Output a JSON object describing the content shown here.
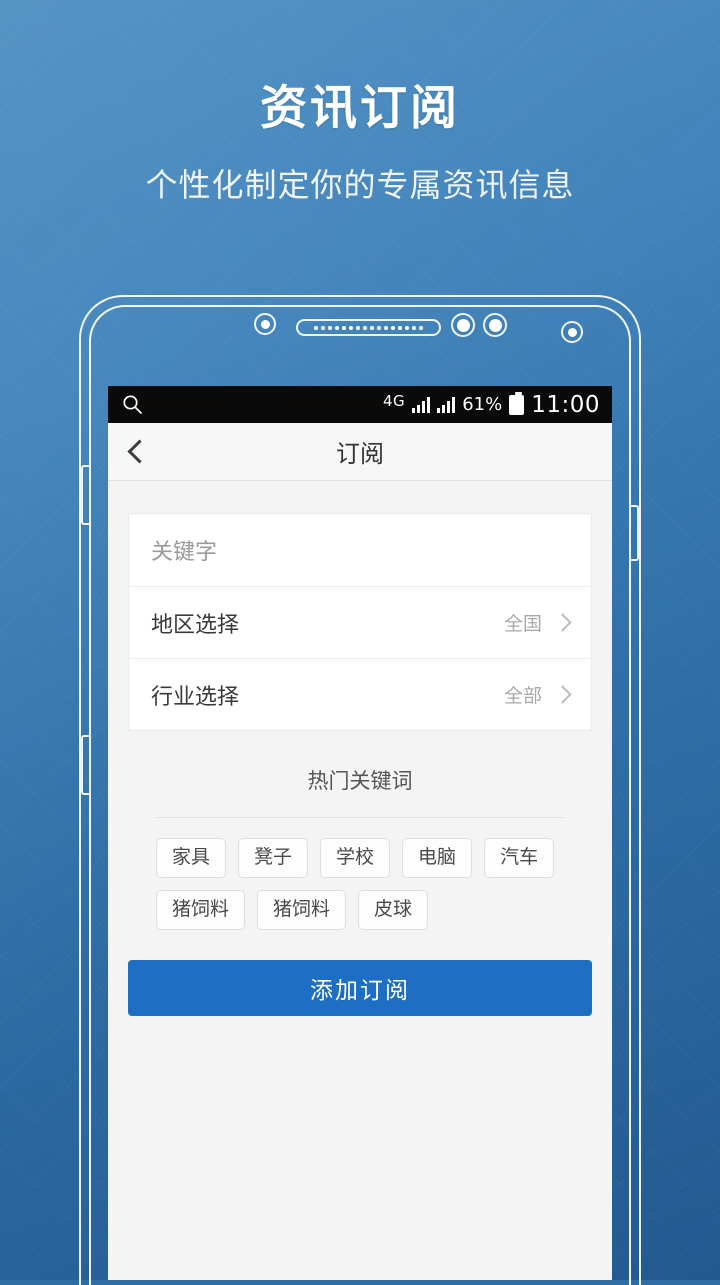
{
  "hero": {
    "title": "资讯订阅",
    "subtitle": "个性化制定你的专属资讯信息"
  },
  "phone": {
    "statusbar": {
      "search_icon": "search-icon",
      "network": "4G",
      "battery_percent": "61%",
      "battery_icon": "battery-icon",
      "clock": "11:00"
    },
    "navbar": {
      "back_icon": "chevron-left-icon",
      "title": "订阅"
    },
    "form": {
      "rows": [
        {
          "label": "关键字",
          "value": "",
          "type": "input",
          "is_placeholder": true
        },
        {
          "label": "地区选择",
          "value": "全国",
          "type": "select",
          "is_placeholder": false
        },
        {
          "label": "行业选择",
          "value": "全部",
          "type": "select",
          "is_placeholder": false
        }
      ]
    },
    "hot_keywords": {
      "title": "热门关键词",
      "tags": [
        "家具",
        "凳子",
        "学校",
        "电脑",
        "汽车",
        "猪饲料",
        "猪饲料",
        "皮球"
      ]
    },
    "submit": {
      "label": "添加订阅"
    }
  },
  "colors": {
    "background_blue_light": "#4a8cc0",
    "background_blue_dark": "#23598f",
    "accent_button": "#1e6fc4",
    "screen_bg": "#f4f4f4",
    "card_bg": "#ffffff",
    "statusbar_bg": "#0a0a0a"
  }
}
